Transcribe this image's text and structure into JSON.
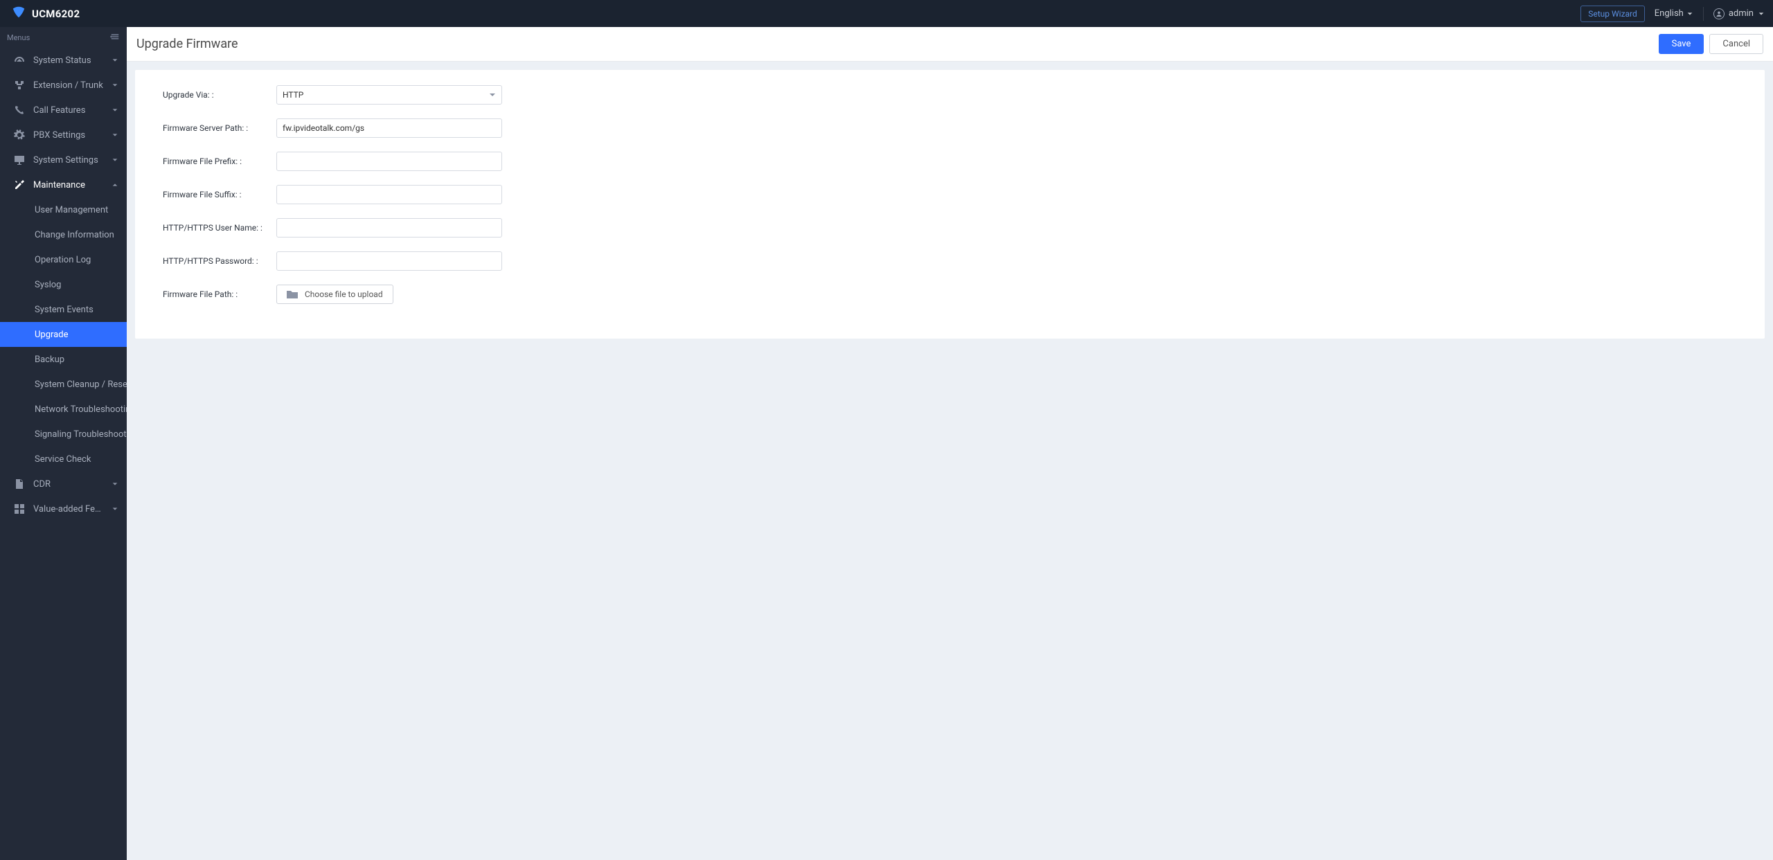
{
  "product": "UCM6202",
  "header": {
    "setup_wizard": "Setup Wizard",
    "language": "English",
    "user": "admin"
  },
  "sidebar": {
    "menus_label": "Menus",
    "groups": [
      {
        "label": "System Status"
      },
      {
        "label": "Extension / Trunk"
      },
      {
        "label": "Call Features"
      },
      {
        "label": "PBX Settings"
      },
      {
        "label": "System Settings"
      },
      {
        "label": "Maintenance"
      },
      {
        "label": "CDR"
      },
      {
        "label": "Value-added Features"
      }
    ],
    "maintenance_items": [
      "User Management",
      "Change Information",
      "Operation Log",
      "Syslog",
      "System Events",
      "Upgrade",
      "Backup",
      "System Cleanup / Reset",
      "Network Troubleshooting",
      "Signaling Troubleshooting",
      "Service Check"
    ]
  },
  "page": {
    "title": "Upgrade Firmware",
    "save": "Save",
    "cancel": "Cancel"
  },
  "form": {
    "upgrade_via_label": "Upgrade Via: :",
    "upgrade_via_value": "HTTP",
    "server_path_label": "Firmware Server Path: :",
    "server_path_value": "fw.ipvideotalk.com/gs",
    "prefix_label": "Firmware File Prefix: :",
    "prefix_value": "",
    "suffix_label": "Firmware File Suffix: :",
    "suffix_value": "",
    "user_label": "HTTP/HTTPS User Name: :",
    "user_value": "",
    "pass_label": "HTTP/HTTPS Password: :",
    "pass_value": "",
    "file_path_label": "Firmware File Path: :",
    "choose_file": "Choose file to upload"
  }
}
